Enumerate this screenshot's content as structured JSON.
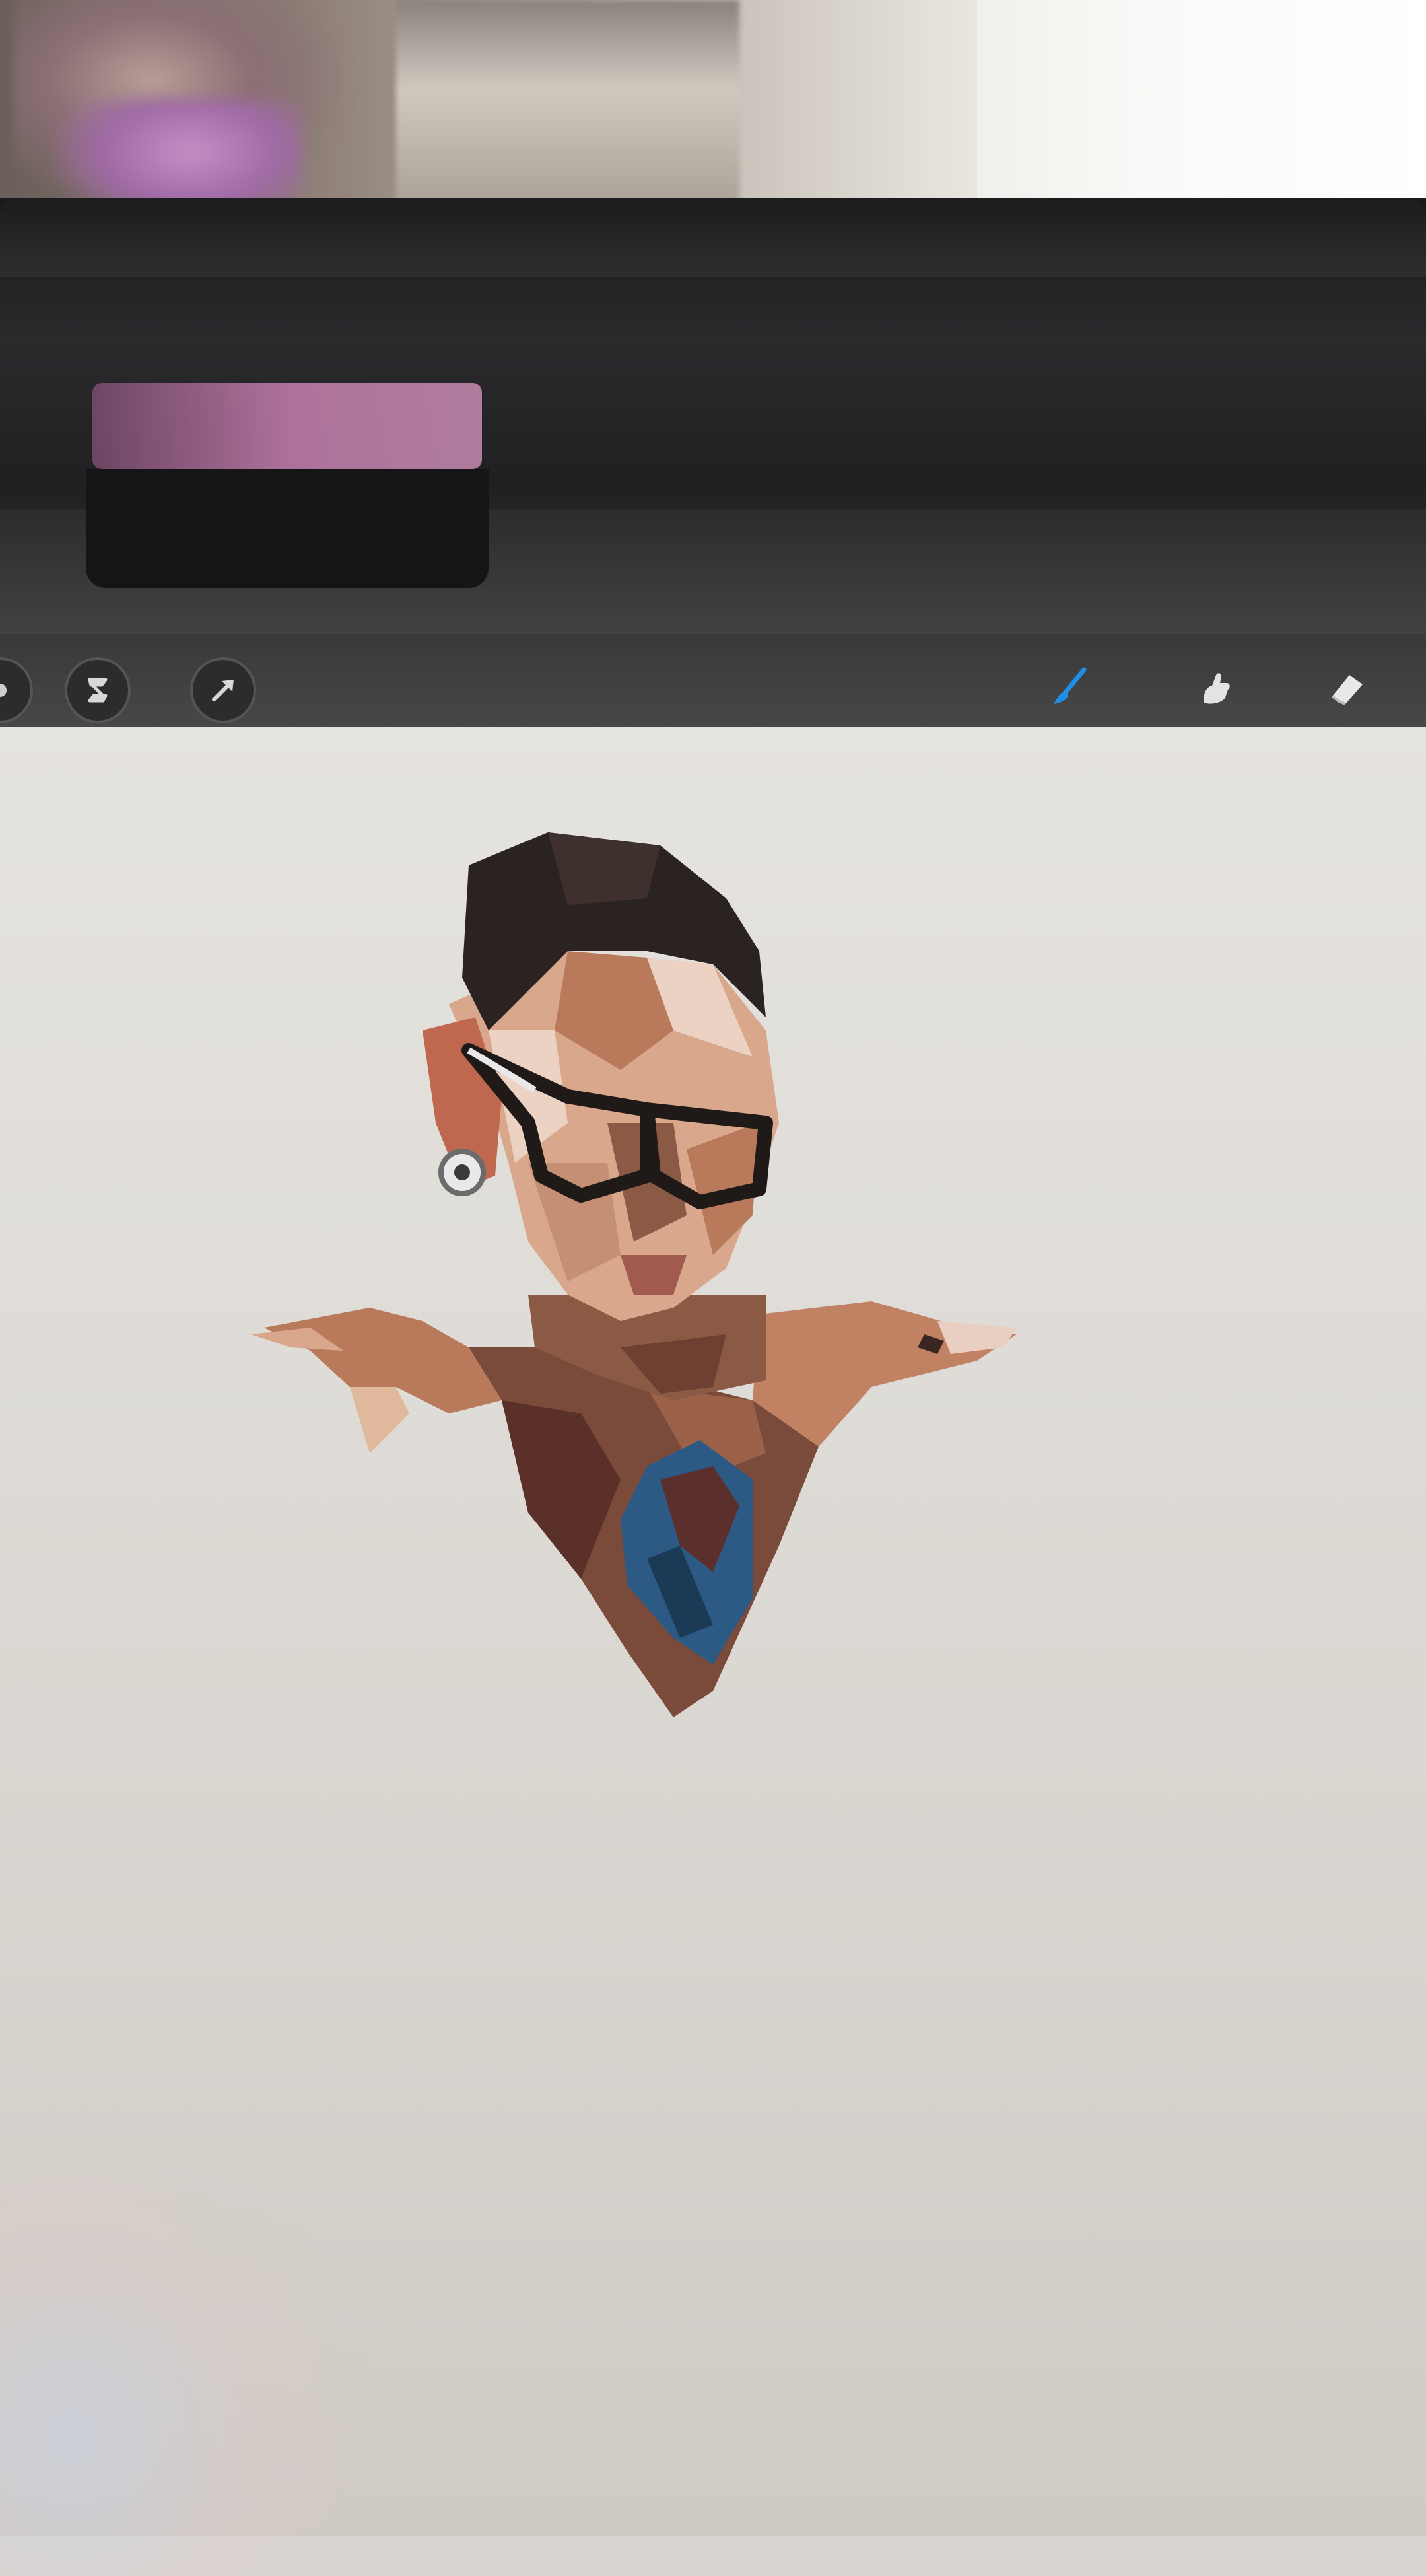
{
  "scene": {
    "background_colors": {
      "canvas": "#e2dfda",
      "device_frame": "#242426",
      "toolbar": "#444343",
      "accent_brush": "#1e8ee6"
    }
  },
  "toolbar": {
    "left_tools": [
      {
        "icon": "adjustments-icon",
        "label": ""
      },
      {
        "icon": "selection-icon",
        "label": ""
      },
      {
        "icon": "transform-arrow-icon",
        "label": ""
      }
    ],
    "right_tools": [
      {
        "icon": "brush-icon",
        "active": true
      },
      {
        "icon": "smudge-icon",
        "active": false
      },
      {
        "icon": "eraser-icon",
        "active": false
      }
    ]
  },
  "artwork": {
    "subject": "low-poly-portrait",
    "palette": [
      "#2b2321",
      "#3e302c",
      "#8a5a44",
      "#b97a5c",
      "#d9a88c",
      "#ecd2c3",
      "#5b2f2b",
      "#1b3a55",
      "#2c5a84"
    ]
  }
}
